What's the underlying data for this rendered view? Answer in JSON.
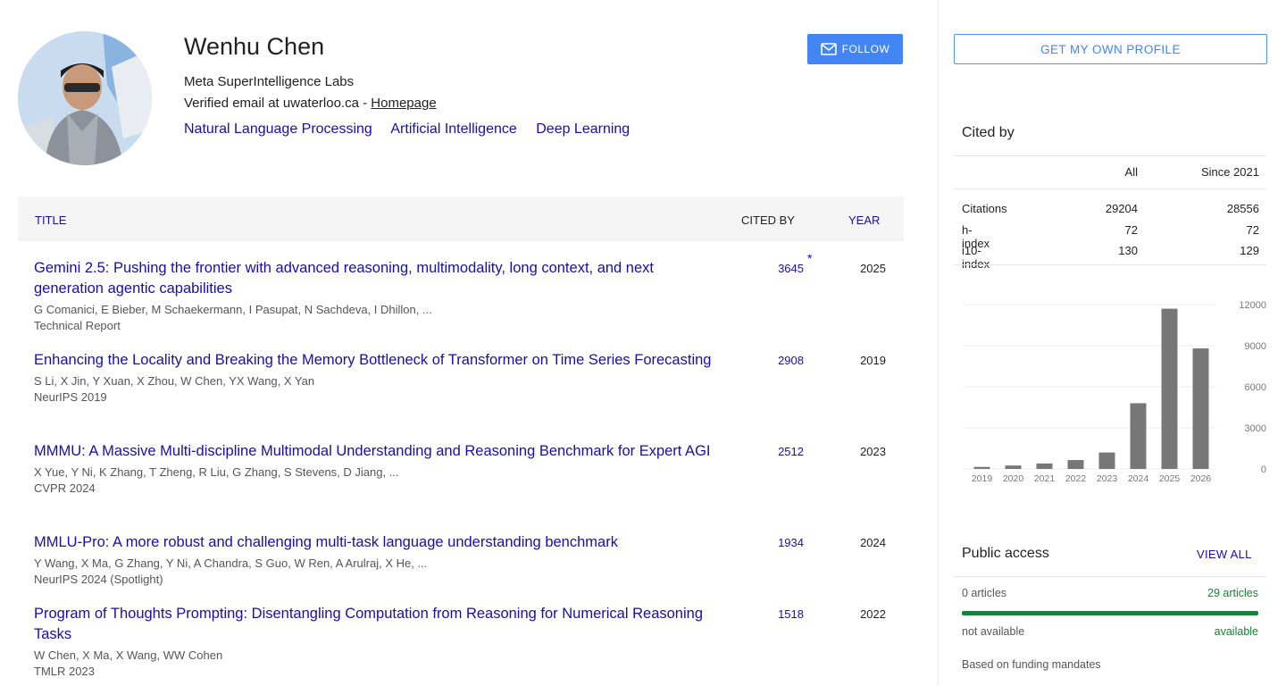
{
  "profile": {
    "name": "Wenhu Chen",
    "affiliation": "Meta SuperIntelligence Labs",
    "email_text": "Verified email at uwaterloo.ca - ",
    "homepage_label": "Homepage",
    "interests": [
      "Natural Language Processing",
      "Artificial Intelligence",
      "Deep Learning"
    ],
    "follow_label": "FOLLOW"
  },
  "table": {
    "col_title": "TITLE",
    "col_cited": "CITED BY",
    "col_year": "YEAR",
    "rows": [
      {
        "title": "Gemini 2.5: Pushing the frontier with advanced reasoning, multimodality, long context, and next generation agentic capabilities",
        "authors": "G Comanici, E Bieber, M Schaekermann, I Pasupat, N Sachdeva, I Dhillon, ...",
        "venue": "Technical Report",
        "cited": "3645",
        "star": "*",
        "year": "2025"
      },
      {
        "title": "Enhancing the Locality and Breaking the Memory Bottleneck of Transformer on Time Series Forecasting",
        "authors": "S Li, X Jin, Y Xuan, X Zhou, W Chen, YX Wang, X Yan",
        "venue": "NeurIPS 2019",
        "cited": "2908",
        "star": "",
        "year": "2019"
      },
      {
        "title": "MMMU: A Massive Multi-discipline Multimodal Understanding and Reasoning Benchmark for Expert AGI",
        "authors": "X Yue, Y Ni, K Zhang, T Zheng, R Liu, G Zhang, S Stevens, D Jiang, ...",
        "venue": "CVPR 2024",
        "cited": "2512",
        "star": "",
        "year": "2023"
      },
      {
        "title": "MMLU-Pro: A more robust and challenging multi-task language understanding benchmark",
        "authors": "Y Wang, X Ma, G Zhang, Y Ni, A Chandra, S Guo, W Ren, A Arulraj, X He, ...",
        "venue": "NeurIPS 2024 (Spotlight)",
        "cited": "1934",
        "star": "",
        "year": "2024"
      },
      {
        "title": "Program of Thoughts Prompting: Disentangling Computation from Reasoning for Numerical Reasoning Tasks",
        "authors": "W Chen, X Ma, X Wang, WW Cohen",
        "venue": "TMLR 2023",
        "cited": "1518",
        "star": "",
        "year": "2022"
      }
    ]
  },
  "sidebar": {
    "own_profile_label": "GET MY OWN PROFILE",
    "cited_by_title": "Cited by",
    "stats_headers": [
      "All",
      "Since 2021"
    ],
    "stats": [
      {
        "label": "Citations",
        "all": "29204",
        "since": "28556"
      },
      {
        "label": "h-index",
        "all": "72",
        "since": "72"
      },
      {
        "label": "i10-index",
        "all": "130",
        "since": "129"
      }
    ],
    "public_access": {
      "title": "Public access",
      "view_all": "VIEW ALL",
      "left_count": "0 articles",
      "right_count": "29 articles",
      "left_status": "not available",
      "right_status": "available",
      "note": "Based on funding mandates",
      "available_fraction": 1.0
    }
  },
  "colors": {
    "link": "#1a0dab",
    "follow_button": "#4285f4",
    "bar": "#777777",
    "available_green": "#188038"
  },
  "chart_data": {
    "type": "bar",
    "categories": [
      "2019",
      "2020",
      "2021",
      "2022",
      "2023",
      "2024",
      "2025",
      "2026"
    ],
    "values": [
      150,
      250,
      400,
      650,
      1200,
      4800,
      11700,
      8800
    ],
    "yticks": [
      "12000",
      "9000",
      "6000",
      "3000",
      "0"
    ],
    "ylim": [
      0,
      12000
    ],
    "grid": true
  }
}
